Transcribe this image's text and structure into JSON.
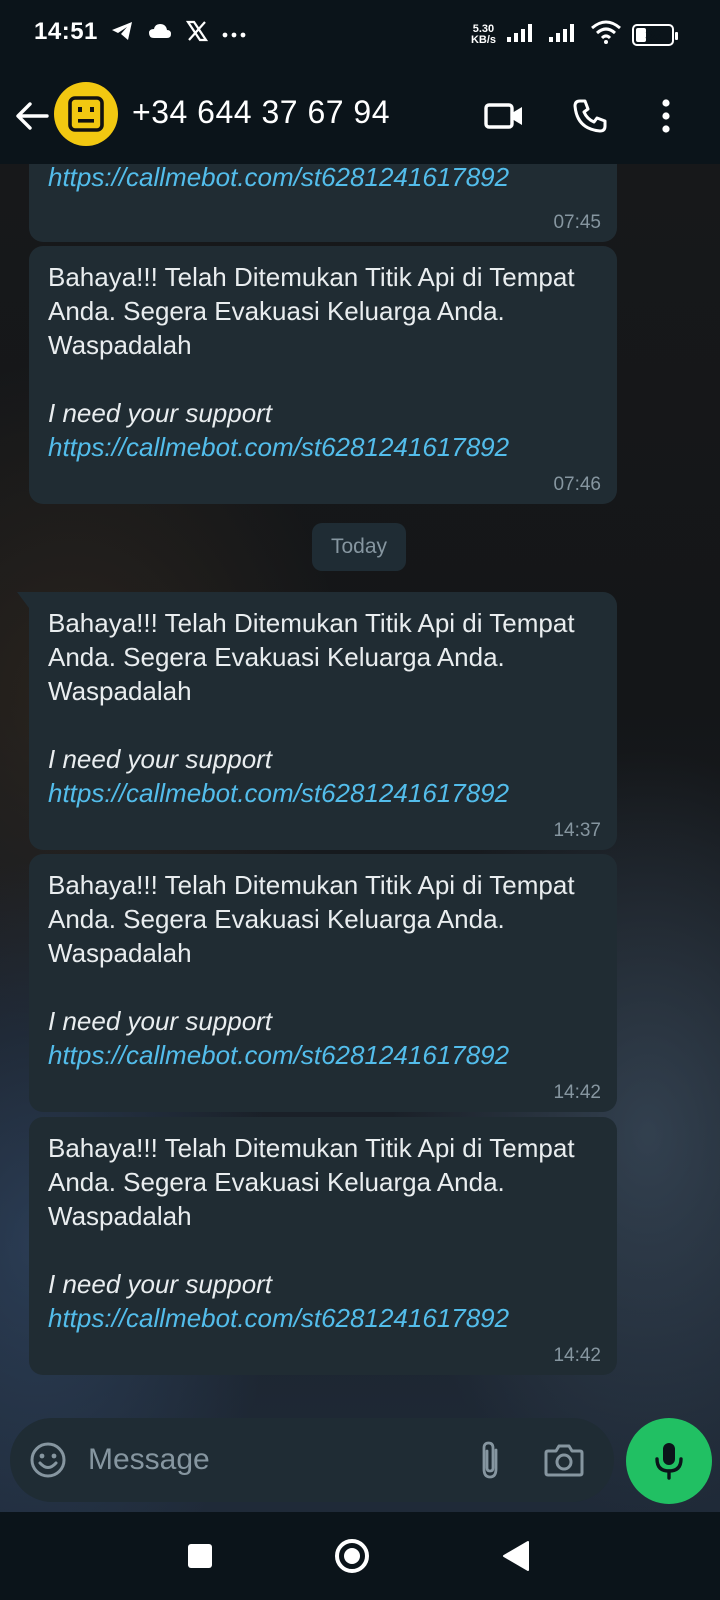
{
  "status_bar": {
    "time": "14:51",
    "left_icons": [
      "telegram-icon",
      "cloud-icon",
      "x-icon",
      "more-dots-icon"
    ],
    "net_speed_value": "5.30",
    "net_speed_unit": "KB/s",
    "battery": "38",
    "battery_level": 0.38
  },
  "header": {
    "contact_name": "+34 644 37 67 94",
    "avatar_color": "#f2c811"
  },
  "messages": [
    {
      "link": "https://callmebot.com/st6281241617892",
      "time": "07:45"
    },
    {
      "text": "Bahaya!!! Telah Ditemukan Titik Api di Tempat Anda. Segera Evakuasi Keluarga Anda. Waspadalah",
      "italic": "I need your support",
      "link": "https://callmebot.com/st6281241617892",
      "time": "07:46"
    },
    {
      "text": "Bahaya!!! Telah Ditemukan Titik Api di Tempat Anda. Segera Evakuasi Keluarga Anda. Waspadalah",
      "italic": "I need your support",
      "link": "https://callmebot.com/st6281241617892",
      "time": "14:37"
    },
    {
      "text": "Bahaya!!! Telah Ditemukan Titik Api di Tempat Anda. Segera Evakuasi Keluarga Anda. Waspadalah",
      "italic": "I need your support",
      "link": "https://callmebot.com/st6281241617892",
      "time": "14:42"
    },
    {
      "text": "Bahaya!!! Telah Ditemukan Titik Api di Tempat Anda. Segera Evakuasi Keluarga Anda. Waspadalah",
      "italic": "I need your support",
      "link": "https://callmebot.com/st6281241617892",
      "time": "14:42"
    }
  ],
  "date_separator": "Today",
  "composer": {
    "placeholder": "Message"
  },
  "colors": {
    "background": "#0b141a",
    "bubble": "#202c33",
    "link": "#53bdeb",
    "accent_green": "#21c063",
    "timestamp": "#8696a0"
  }
}
